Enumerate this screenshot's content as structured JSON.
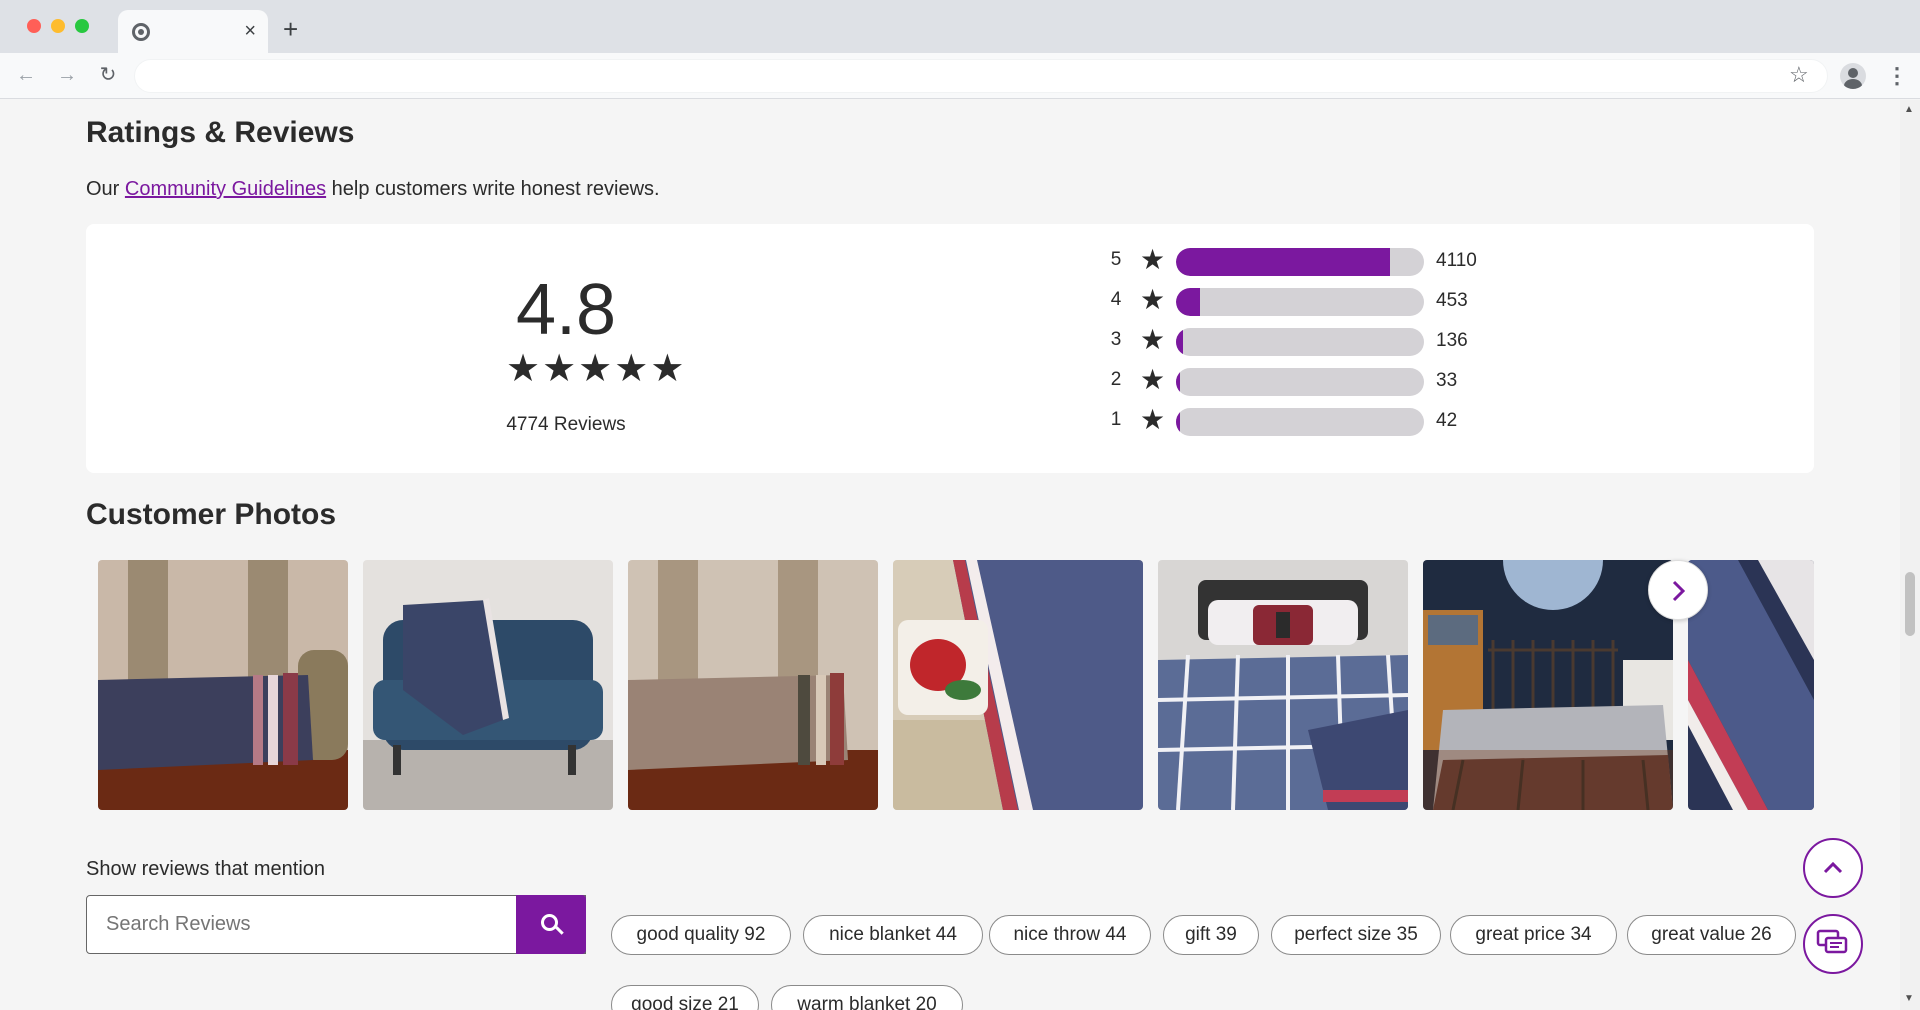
{
  "browser": {
    "tab_close": "×",
    "new_tab": "+",
    "back_icon": "arrow-left-icon",
    "forward_icon": "arrow-right-icon",
    "reload_icon": "reload-icon"
  },
  "reviews": {
    "title": "Ratings & Reviews",
    "guidelines_prefix": "Our ",
    "guidelines_link": "Community Guidelines",
    "guidelines_suffix": " help customers write honest reviews.",
    "average": "4.8",
    "average_stars": 5,
    "review_count": "4774 Reviews",
    "distribution": [
      {
        "stars": "5",
        "count": "4110",
        "fraction": 0.861
      },
      {
        "stars": "4",
        "count": "453",
        "fraction": 0.095
      },
      {
        "stars": "3",
        "count": "136",
        "fraction": 0.028
      },
      {
        "stars": "2",
        "count": "33",
        "fraction": 0.007
      },
      {
        "stars": "1",
        "count": "42",
        "fraction": 0.009
      }
    ]
  },
  "photos": {
    "title": "Customer Photos",
    "items": [
      {
        "name": "photo-blanket-on-sofa-dark"
      },
      {
        "name": "photo-blanket-on-blue-loveseat"
      },
      {
        "name": "photo-blanket-on-sofa-light"
      },
      {
        "name": "photo-blanket-with-cardinal-pillow"
      },
      {
        "name": "photo-plaid-bed-with-deer-pillow"
      },
      {
        "name": "photo-plaid-bed-with-iron-headboard"
      },
      {
        "name": "photo-blanket-closeup"
      }
    ]
  },
  "mentions": {
    "label": "Show reviews that mention",
    "search_placeholder": "Search Reviews",
    "chips": [
      "good quality 92",
      "nice blanket 44",
      "nice throw 44",
      "gift 39",
      "perfect size 35",
      "great price 34",
      "great value 26",
      "good size 21",
      "warm blanket 20"
    ]
  },
  "colors": {
    "accent": "#7b189f",
    "track": "#d4d2d6"
  }
}
